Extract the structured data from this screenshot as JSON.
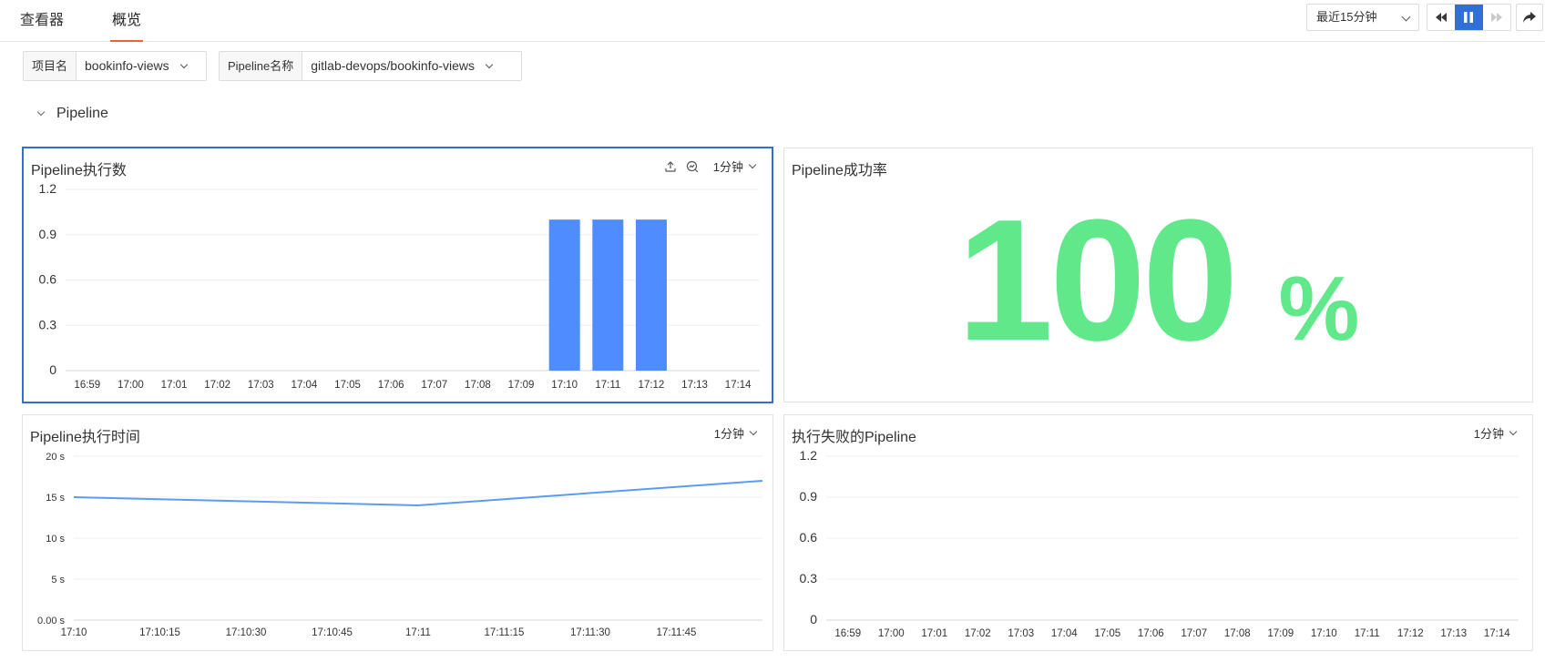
{
  "tabs": [
    {
      "label": "查看器",
      "active": false
    },
    {
      "label": "概览",
      "active": true
    }
  ],
  "toolbar": {
    "time_range": "最近15分钟",
    "rewind_icon": "rewind-icon",
    "pause_icon": "pause-icon",
    "forward_icon": "fast-forward-icon",
    "share_icon": "share-icon",
    "accent_color": "#2f6fd6"
  },
  "filters": [
    {
      "label": "项目名",
      "value": "bookinfo-views"
    },
    {
      "label": "Pipeline名称",
      "value": "gitlab-devops/bookinfo-views"
    }
  ],
  "section": {
    "title": "Pipeline"
  },
  "panels": {
    "executions": {
      "title": "Pipeline执行数",
      "interval": "1分钟",
      "export_icon": "export-icon",
      "explore_icon": "explore-icon"
    },
    "success_rate": {
      "title": "Pipeline成功率",
      "value": "100",
      "unit": "%",
      "color": "#61e88a"
    },
    "duration": {
      "title": "Pipeline执行时间",
      "interval": "1分钟"
    },
    "failed": {
      "title": "执行失败的Pipeline",
      "interval": "1分钟"
    }
  },
  "chart_data": [
    {
      "id": "executions",
      "type": "bar",
      "categories": [
        "16:59",
        "17:00",
        "17:01",
        "17:02",
        "17:03",
        "17:04",
        "17:05",
        "17:06",
        "17:07",
        "17:08",
        "17:09",
        "17:10",
        "17:11",
        "17:12",
        "17:13",
        "17:14"
      ],
      "values": [
        0,
        0,
        0,
        0,
        0,
        0,
        0,
        0,
        0,
        0,
        0,
        1,
        1,
        1,
        0,
        0
      ],
      "yticks": [
        "0",
        "0.3",
        "0.6",
        "0.9",
        "1.2"
      ],
      "ylim": [
        0,
        1.2
      ],
      "color": "#4e8cff",
      "grid": true
    },
    {
      "id": "duration",
      "type": "line",
      "x": [
        "17:10",
        "17:11",
        "17:11:59"
      ],
      "values": [
        15,
        14,
        17
      ],
      "xticks": [
        "17:10",
        "17:10:15",
        "17:10:30",
        "17:10:45",
        "17:11",
        "17:11:15",
        "17:11:30",
        "17:11:45"
      ],
      "yticks": [
        "0.00 s",
        "5 s",
        "10 s",
        "15 s",
        "20 s"
      ],
      "ylim": [
        0,
        20
      ],
      "color": "#5b9bf5",
      "grid": true
    },
    {
      "id": "failed",
      "type": "line",
      "categories": [
        "16:59",
        "17:00",
        "17:01",
        "17:02",
        "17:03",
        "17:04",
        "17:05",
        "17:06",
        "17:07",
        "17:08",
        "17:09",
        "17:10",
        "17:11",
        "17:12",
        "17:13",
        "17:14"
      ],
      "values": [],
      "yticks": [
        "0",
        "0.3",
        "0.6",
        "0.9",
        "1.2"
      ],
      "ylim": [
        0,
        1.2
      ],
      "grid": true
    }
  ]
}
